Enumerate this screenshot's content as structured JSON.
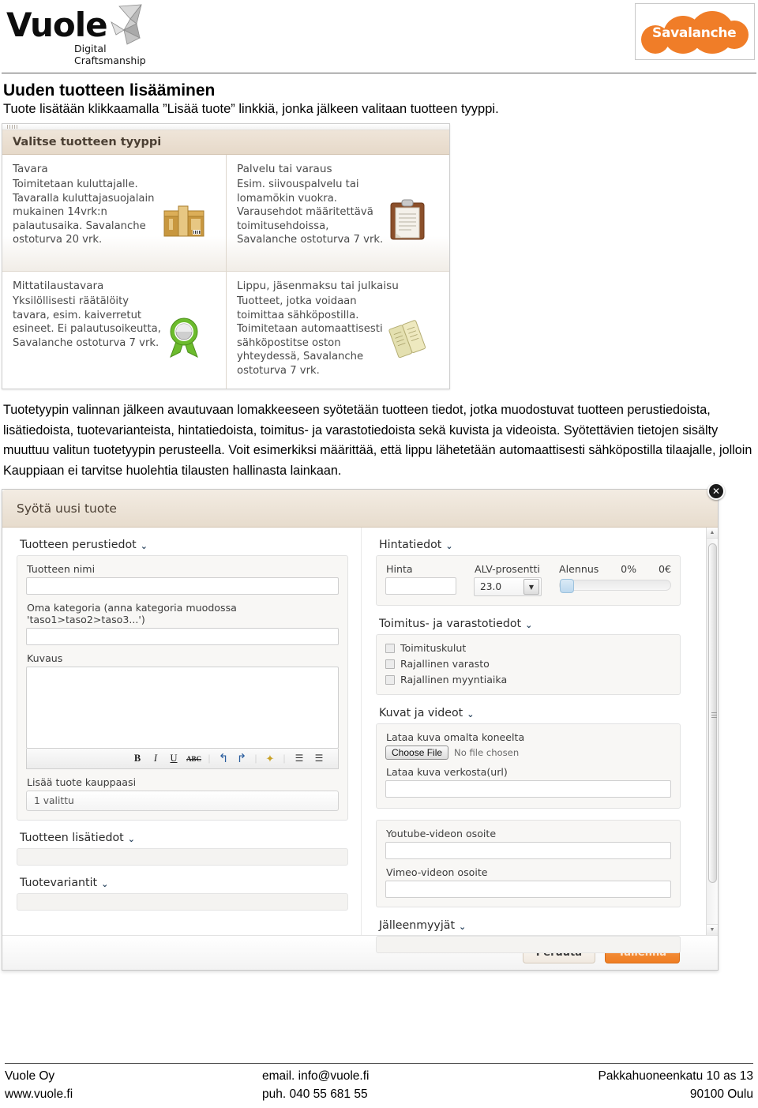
{
  "header": {
    "logo_word": "Vuole",
    "logo_tagline": "Digital Craftsmanship",
    "partner_logo": "Savalanche"
  },
  "doc": {
    "title": "Uuden tuotteen lisääminen",
    "subtitle": "Tuote lisätään klikkaamalla ”Lisää tuote” linkkiä, jonka jälkeen valitaan tuotteen tyyppi.",
    "paragraph": "Tuotetyypin valinnan jälkeen avautuvaan lomakkeeseen syötetään tuotteen tiedot, jotka muodostuvat tuotteen perustiedoista, lisätiedoista, tuotevarianteista, hintatiedoista, toimitus- ja varastotiedoista sekä kuvista ja videoista. Syötettävien tietojen sisälty muuttuu valitun tuotetyypin perusteella. Voit esimerkiksi määrittää, että lippu lähetetään automaattisesti sähköpostilla tilaajalle, jolloin Kauppiaan ei tarvitse huolehtia tilausten hallinasta lainkaan."
  },
  "type_chooser": {
    "heading": "Valitse tuotteen tyyppi",
    "options": [
      {
        "title": "Tavara",
        "desc": "Toimitetaan kuluttajalle. Tavaralla kuluttajasuojalain mukainen 14vrk:n palautusaika. Savalanche ostoturva 20 vrk.",
        "icon": "box-icon"
      },
      {
        "title": "Palvelu tai varaus",
        "desc": "Esim. siivouspalvelu tai lomamökin vuokra. Varausehdot määritettävä toimitusehdoissa, Savalanche ostoturva 7 vrk.",
        "icon": "clipboard-icon"
      },
      {
        "title": "Mittatilaustavara",
        "desc": "Yksilöllisesti räätälöity tavara, esim. kaiverretut esineet. Ei palautusoikeutta, Savalanche ostoturva 7 vrk.",
        "icon": "rosette-icon"
      },
      {
        "title": "Lippu, jäsenmaksu tai julkaisu",
        "desc": "Tuotteet, jotka voidaan toimittaa sähköpostilla. Toimitetaan automaattisesti sähköpostitse oston yhteydessä, Savalanche ostoturva 7 vrk.",
        "icon": "tickets-icon"
      }
    ]
  },
  "product_form": {
    "window_title": "Syötä uusi tuote",
    "close_label": "✕",
    "left": {
      "basics_section": "Tuotteen perustiedot",
      "name_label": "Tuotteen nimi",
      "name_value": "",
      "category_label": "Oma kategoria (anna kategoria muodossa 'taso1>taso2>taso3...')",
      "category_value": "",
      "description_label": "Kuvaus",
      "description_value": "",
      "toolbar": {
        "bold": "B",
        "italic": "I",
        "underline": "U",
        "strike": "ABC",
        "undo": "↰",
        "redo": "↱",
        "eraser": "✦",
        "bullet_list": "☰",
        "numbered_list": "☰"
      },
      "shop_label": "Lisää tuote kauppaasi",
      "shop_value": "1 valittu",
      "extra_section": "Tuotteen lisätiedot",
      "variants_section": "Tuotevariantit"
    },
    "right": {
      "price_section": "Hintatiedot",
      "price_label": "Hinta",
      "price_value": "",
      "vat_label": "ALV-prosentti",
      "vat_value": "23.0",
      "discount_label": "Alennus",
      "discount_percent": "0%",
      "discount_euro": "0€",
      "delivery_section": "Toimitus- ja varastotiedot",
      "checkboxes": [
        {
          "label": "Toimituskulut",
          "checked": false
        },
        {
          "label": "Rajallinen varasto",
          "checked": false
        },
        {
          "label": "Rajallinen myyntiaika",
          "checked": false
        }
      ],
      "media_section": "Kuvat ja videot",
      "upload_label": "Lataa kuva omalta koneelta",
      "choose_file_button": "Choose File",
      "no_file_text": "No file chosen",
      "url_label": "Lataa kuva verkosta(url)",
      "url_value": "",
      "youtube_label": "Youtube-videon osoite",
      "youtube_value": "",
      "vimeo_label": "Vimeo-videon osoite",
      "vimeo_value": "",
      "resellers_section": "Jälleenmyyjät"
    },
    "footer": {
      "cancel": "Peruuta",
      "save": "Tallenna"
    }
  },
  "page_footer": {
    "col1_line1": "Vuole Oy",
    "col1_line2": "www.vuole.fi",
    "col2_line1": "email. info@vuole.fi",
    "col2_line2": "puh. 040 55 681 55",
    "col3_line1": "Pakkahuoneenkatu 10 as 13",
    "col3_line2": "90100 Oulu"
  },
  "colors": {
    "brand_orange": "#ef7d22",
    "header_beige": "#e7dccd"
  }
}
